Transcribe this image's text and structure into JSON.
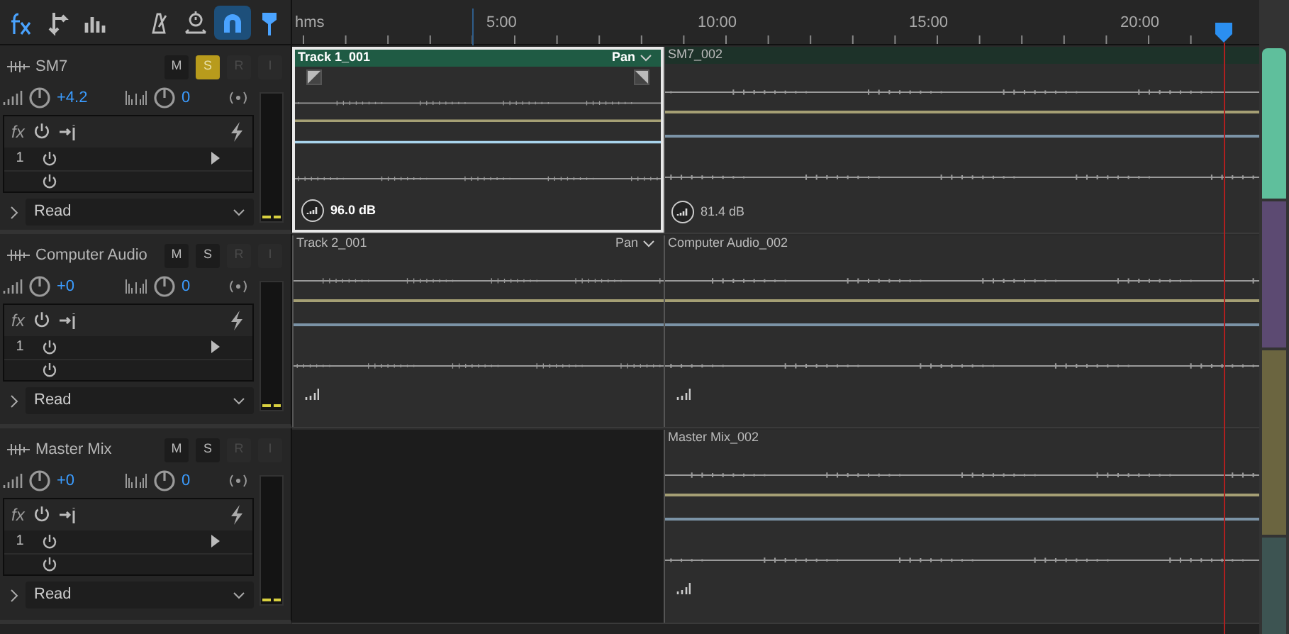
{
  "toolbar": {
    "tools": [
      {
        "kind": "fx",
        "selected": true
      },
      {
        "kind": "sends",
        "selected": false
      },
      {
        "kind": "eq",
        "selected": false
      },
      {
        "kind": "metronome",
        "selected": false
      },
      {
        "kind": "timer",
        "selected": false
      },
      {
        "kind": "snap",
        "selected": true
      },
      {
        "kind": "marker",
        "selected": true
      }
    ]
  },
  "ruler": {
    "unit": "hms",
    "labels": [
      "5:00",
      "10:00",
      "15:00",
      "20:00"
    ]
  },
  "tracks": [
    {
      "name": "SM7",
      "buttons": [
        {
          "label": "M",
          "on": false,
          "disabled": false
        },
        {
          "label": "S",
          "on": true,
          "disabled": false
        },
        {
          "label": "R",
          "on": false,
          "disabled": true
        },
        {
          "label": "I",
          "on": false,
          "disabled": true
        }
      ],
      "volume": "+4.2",
      "pan": "0",
      "rack_label": "fx",
      "fx_slot": "1",
      "automation": "Read",
      "leading_gap": false,
      "clips": [
        {
          "name": "Track 1_001",
          "selected": true,
          "pan_label": "Pan",
          "gain": "96.0 dB",
          "fades": true
        },
        {
          "name": "SM7_002",
          "selected": false,
          "gain": "81.4 dB",
          "fades": false
        }
      ]
    },
    {
      "name": "Computer Audio",
      "buttons": [
        {
          "label": "M",
          "on": false,
          "disabled": false
        },
        {
          "label": "S",
          "on": false,
          "disabled": false
        },
        {
          "label": "R",
          "on": false,
          "disabled": true
        },
        {
          "label": "I",
          "on": false,
          "disabled": true
        }
      ],
      "volume": "+0",
      "pan": "0",
      "rack_label": "fx",
      "fx_slot": "1",
      "automation": "Read",
      "leading_gap": false,
      "clips": [
        {
          "name": "Track 2_001",
          "selected": false,
          "pan_label": "Pan",
          "fades": false
        },
        {
          "name": "Computer Audio_002",
          "selected": false,
          "fades": false
        }
      ]
    },
    {
      "name": "Master Mix",
      "buttons": [
        {
          "label": "M",
          "on": false,
          "disabled": false
        },
        {
          "label": "S",
          "on": false,
          "disabled": false
        },
        {
          "label": "R",
          "on": false,
          "disabled": true
        },
        {
          "label": "I",
          "on": false,
          "disabled": true
        }
      ],
      "volume": "+0",
      "pan": "0",
      "rack_label": "fx",
      "fx_slot": "1",
      "automation": "Read",
      "leading_gap": true,
      "clips": [
        {
          "name": "Master Mix_002",
          "selected": false,
          "fades": false
        }
      ]
    }
  ]
}
